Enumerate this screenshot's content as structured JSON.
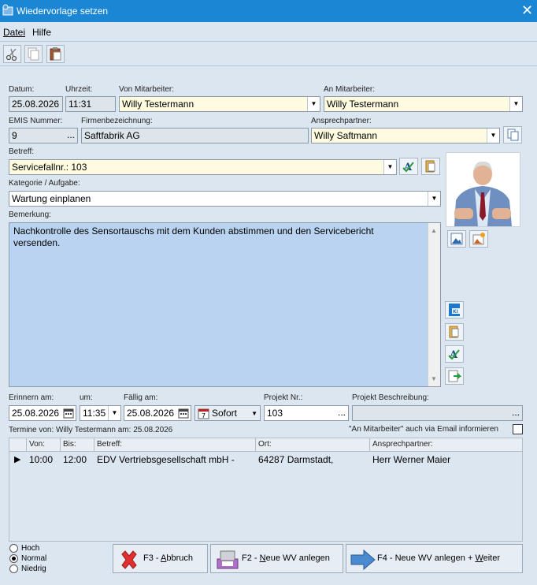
{
  "window": {
    "title": "Wiedervorlage setzen"
  },
  "menu": {
    "datei": "Datei",
    "hilfe": "Hilfe"
  },
  "labels": {
    "datum": "Datum:",
    "uhrzeit": "Uhrzeit:",
    "von": "Von Mitarbeiter:",
    "an": "An Mitarbeiter:",
    "emis": "EMIS Nummer:",
    "firma": "Firmenbezeichnung:",
    "ansprech": "Ansprechpartner:",
    "betreff": "Betreff:",
    "kategorie": "Kategorie / Aufgabe:",
    "bemerkung": "Bemerkung:",
    "erinnern": "Erinnern am:",
    "um": "um:",
    "faellig": "Fällig am:",
    "projekt_nr": "Projekt Nr.:",
    "projekt_beschr": "Projekt Beschreibung:",
    "termine": "Termine von: Willy Testermann am: 25.08.2026",
    "email_info": "\"An Mitarbeiter\" auch via Email informieren"
  },
  "fields": {
    "datum": "25.08.2026",
    "uhrzeit": "11:31",
    "von": "Willy Testermann",
    "an": "Willy Testermann",
    "emis": "9",
    "firma": "Saftfabrik AG",
    "ansprech": "Willy Saftmann",
    "betreff": "Servicefallnr.: 103",
    "kategorie": "Wartung einplanen",
    "bemerkung": "Nachkontrolle des Sensortauschs mit dem Kunden abstimmen und den Servicebericht versenden.",
    "erinnern_datum": "25.08.2026",
    "erinnern_zeit": "11:35",
    "faellig": "25.08.2026",
    "sofort": "Sofort",
    "projekt_nr": "103",
    "projekt_beschr": ""
  },
  "grid": {
    "headers": [
      "Von:",
      "Bis:",
      "Betreff:",
      "Ort:",
      "Ansprechpartner:"
    ],
    "rows": [
      {
        "von": "10:00",
        "bis": "12:00",
        "betreff": "EDV Vertriebsgesellschaft mbH -",
        "ort": "64287 Darmstadt,",
        "ansprech": "Herr Werner Maier"
      }
    ]
  },
  "priority": {
    "hoch": "Hoch",
    "normal": "Normal",
    "niedrig": "Niedrig",
    "selected": "Normal"
  },
  "buttons": {
    "abbruch_pre": "F3 - ",
    "abbruch_u": "A",
    "abbruch_post": "bbruch",
    "neu_pre": "F2 - ",
    "neu_u": "N",
    "neu_post": "eue WV anlegen",
    "weiter_pre": "F4 - Neue WV anlegen + ",
    "weiter_u": "W",
    "weiter_post": "eiter"
  },
  "colors": {
    "titlebar": "#1a86d4",
    "memo": "#b9d3f0",
    "required": "#fffbe0",
    "window": "#dce6f0"
  },
  "icons": [
    "scissors-icon",
    "copy-icon",
    "paste-icon",
    "close-icon",
    "calendar-icon",
    "dropdown-icon"
  ]
}
